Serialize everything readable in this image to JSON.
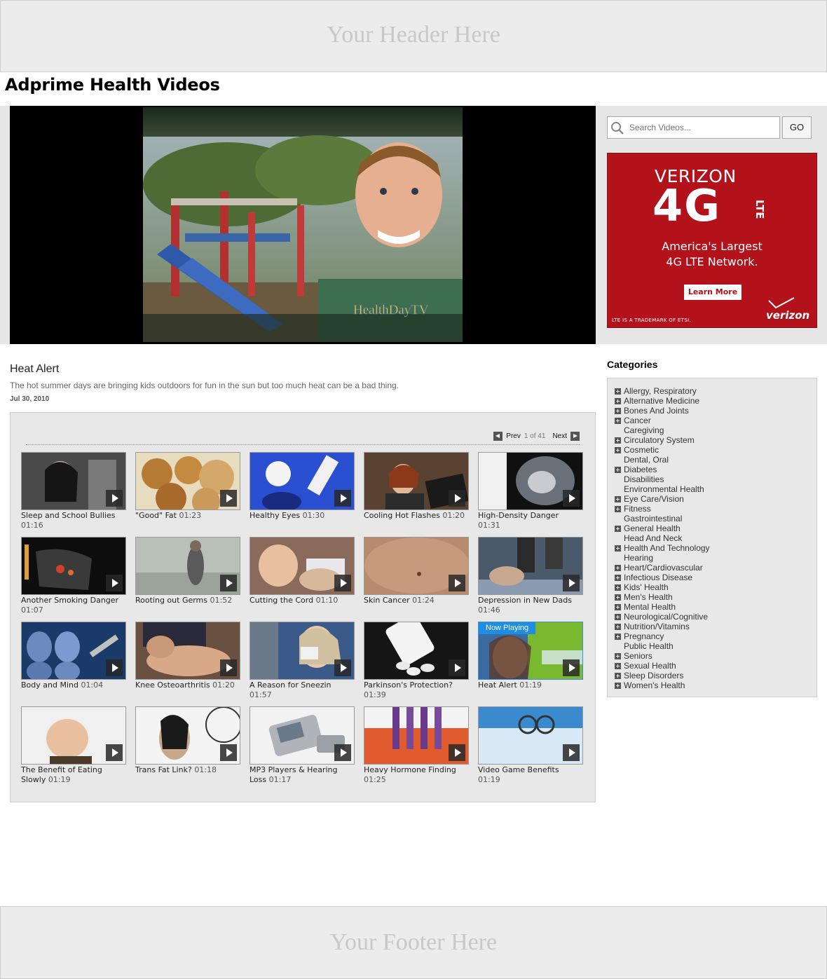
{
  "header": {
    "placeholder": "Your Header Here"
  },
  "page": {
    "title": "Adprime Health Videos"
  },
  "player": {
    "watermark": "HealthDayTV"
  },
  "search": {
    "placeholder": "Search Videos...",
    "button_label": "GO"
  },
  "ad": {
    "brand": "VERIZON",
    "headline": "4G",
    "badge": "LTE",
    "tagline_line1": "America's Largest",
    "tagline_line2": "4G LTE Network.",
    "cta": "Learn More",
    "fineprint": "LTE IS A TRADEMARK OF ETSI.",
    "logo": "verizon",
    "accent": "#b3121a"
  },
  "current_video": {
    "title": "Heat Alert",
    "description": "The hot summer days are bringing kids outdoors for fun in the sun but too much heat can be a bad thing.",
    "date": "Jul 30, 2010"
  },
  "pager": {
    "prev": "Prev",
    "count": "1 of 41",
    "next": "Next"
  },
  "now_playing_label": "Now Playing",
  "videos": [
    {
      "title": "Sleep and School Bullies",
      "duration": "01:16"
    },
    {
      "title": "\"Good\" Fat",
      "duration": "01:23"
    },
    {
      "title": "Healthy Eyes",
      "duration": "01:30"
    },
    {
      "title": "Cooling Hot Flashes",
      "duration": "01:20"
    },
    {
      "title": "High-Density Danger",
      "duration": "01:31"
    },
    {
      "title": "Another Smoking Danger",
      "duration": "01:07"
    },
    {
      "title": "Rooting out Germs",
      "duration": "01:52"
    },
    {
      "title": "Cutting the Cord",
      "duration": "01:10"
    },
    {
      "title": "Skin Cancer",
      "duration": "01:24"
    },
    {
      "title": "Depression in New Dads",
      "duration": "01:46"
    },
    {
      "title": "Body and Mind",
      "duration": "01:04"
    },
    {
      "title": "Knee Osteoarthritis",
      "duration": "01:20"
    },
    {
      "title": "A Reason for Sneezin",
      "duration": "01:57"
    },
    {
      "title": "Parkinson's Protection?",
      "duration": "01:39"
    },
    {
      "title": "Heat Alert",
      "duration": "01:19",
      "now_playing": true
    },
    {
      "title": "The Benefit of Eating Slowly",
      "duration": "01:19"
    },
    {
      "title": "Trans Fat Link?",
      "duration": "01:18"
    },
    {
      "title": "MP3 Players & Hearing Loss",
      "duration": "01:17"
    },
    {
      "title": "Heavy Hormone Finding",
      "duration": "01:25"
    },
    {
      "title": "Video Game Benefits",
      "duration": "01:19"
    }
  ],
  "categories": {
    "heading": "Categories",
    "items": [
      {
        "label": "Allergy, Respiratory",
        "expandable": true
      },
      {
        "label": "Alternative Medicine",
        "expandable": true
      },
      {
        "label": "Bones And Joints",
        "expandable": true
      },
      {
        "label": "Cancer",
        "expandable": true
      },
      {
        "label": "Caregiving",
        "expandable": false
      },
      {
        "label": "Circulatory System",
        "expandable": true
      },
      {
        "label": "Cosmetic",
        "expandable": true
      },
      {
        "label": "Dental, Oral",
        "expandable": false
      },
      {
        "label": "Diabetes",
        "expandable": true
      },
      {
        "label": "Disabilities",
        "expandable": false
      },
      {
        "label": "Environmental Health",
        "expandable": false
      },
      {
        "label": "Eye Care/Vision",
        "expandable": true
      },
      {
        "label": "Fitness",
        "expandable": true
      },
      {
        "label": "Gastrointestinal",
        "expandable": false
      },
      {
        "label": "General Health",
        "expandable": true
      },
      {
        "label": "Head And Neck",
        "expandable": false
      },
      {
        "label": "Health And Technology",
        "expandable": true
      },
      {
        "label": "Hearing",
        "expandable": false
      },
      {
        "label": "Heart/Cardiovascular",
        "expandable": true
      },
      {
        "label": "Infectious Disease",
        "expandable": true
      },
      {
        "label": "Kids' Health",
        "expandable": true
      },
      {
        "label": "Men's Health",
        "expandable": true
      },
      {
        "label": "Mental Health",
        "expandable": true
      },
      {
        "label": "Neurological/Cognitive",
        "expandable": true
      },
      {
        "label": "Nutrition/Vitamins",
        "expandable": true
      },
      {
        "label": "Pregnancy",
        "expandable": true
      },
      {
        "label": "Public Health",
        "expandable": false
      },
      {
        "label": "Seniors",
        "expandable": true
      },
      {
        "label": "Sexual Health",
        "expandable": true
      },
      {
        "label": "Sleep Disorders",
        "expandable": true
      },
      {
        "label": "Women's Health",
        "expandable": true
      }
    ]
  },
  "footer": {
    "placeholder": "Your Footer Here"
  }
}
